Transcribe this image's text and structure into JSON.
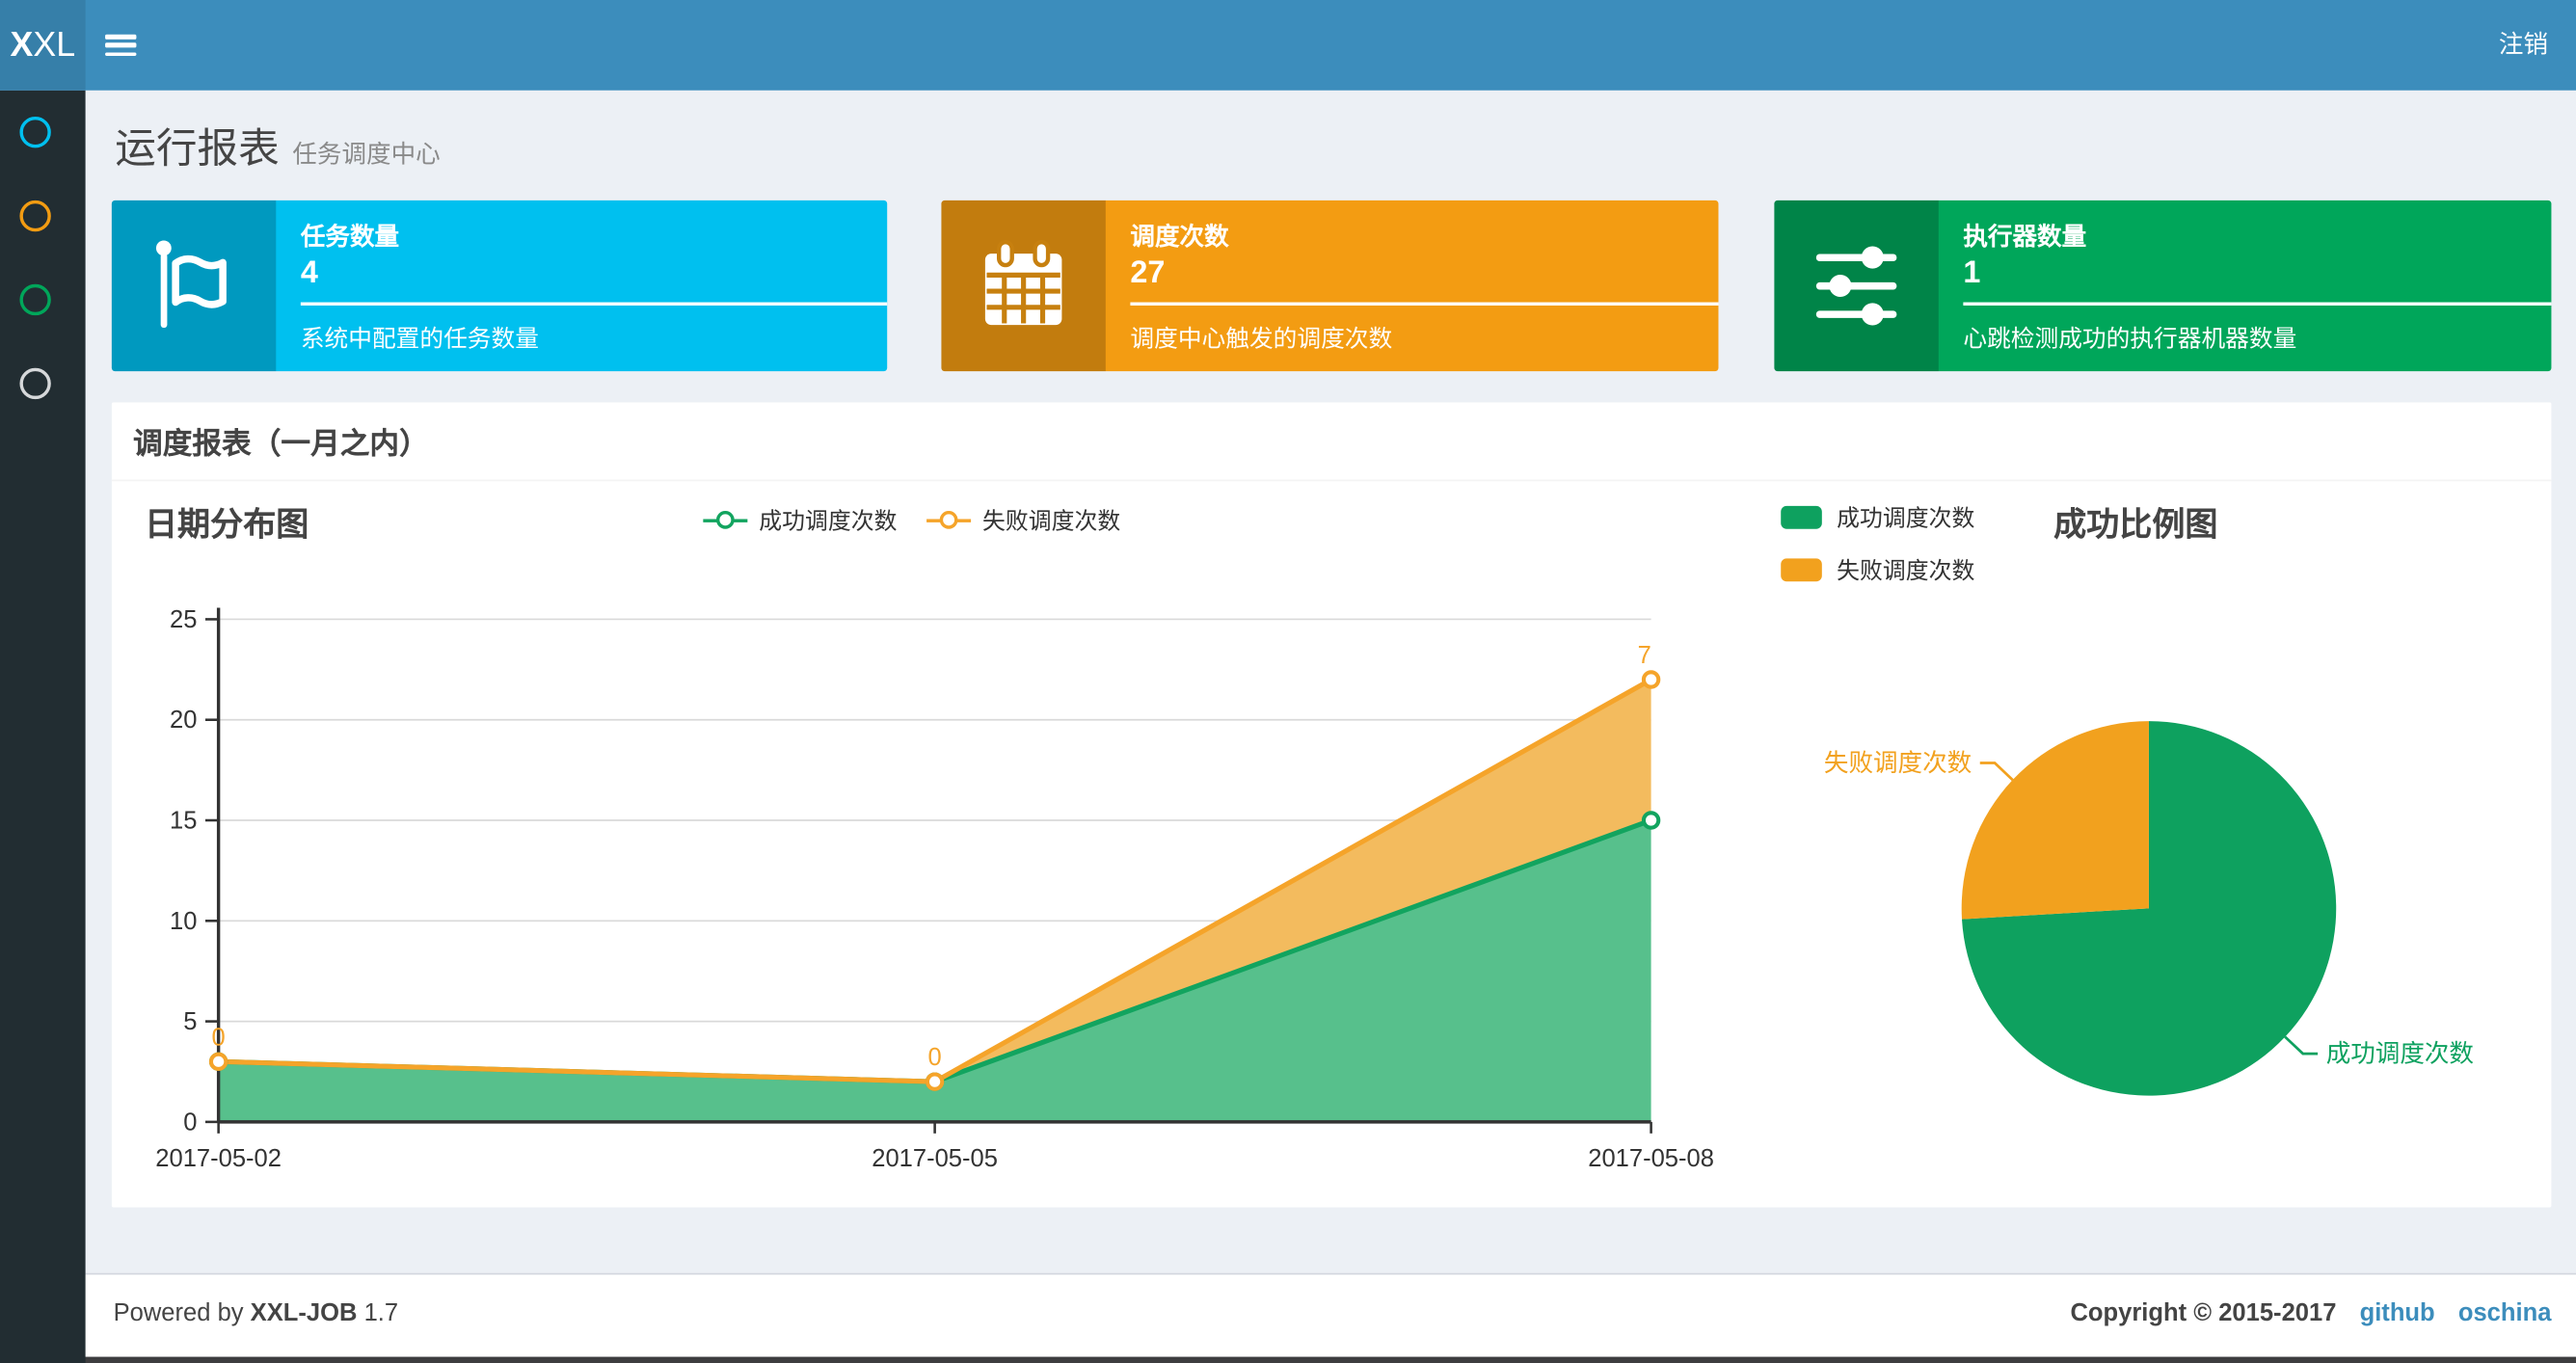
{
  "navbar": {
    "logo_bold": "X",
    "logo_rest": "XL",
    "logout_label": "注销"
  },
  "sidebar": {
    "items": [
      {
        "name": "menu-dot-aqua",
        "color": "#00c0ef"
      },
      {
        "name": "menu-dot-orange",
        "color": "#f39c12"
      },
      {
        "name": "menu-dot-green",
        "color": "#00a65a"
      },
      {
        "name": "menu-dot-white",
        "color": "#d6d8da"
      }
    ]
  },
  "page_header": {
    "title": "运行报表",
    "subtitle": "任务调度中心"
  },
  "info_boxes": [
    {
      "label": "任务数量",
      "value": "4",
      "desc": "系统中配置的任务数量",
      "color": "#00c0ef",
      "icon": "flag-icon"
    },
    {
      "label": "调度次数",
      "value": "27",
      "desc": "调度中心触发的调度次数",
      "color": "#f39c12",
      "icon": "calendar-icon"
    },
    {
      "label": "执行器数量",
      "value": "1",
      "desc": "心跳检测成功的执行器机器数量",
      "color": "#00a65a",
      "icon": "sliders-icon"
    }
  ],
  "panel": {
    "title": "调度报表（一月之内）"
  },
  "chart_data": [
    {
      "type": "area",
      "title": "日期分布图",
      "x": [
        "2017-05-02",
        "2017-05-05",
        "2017-05-08"
      ],
      "series": [
        {
          "name": "成功调度次数",
          "values": [
            3,
            2,
            15
          ],
          "line_color": "#12a45f",
          "area_color": "#57c08c"
        },
        {
          "name": "失败调度次数",
          "values": [
            0,
            0,
            7
          ],
          "line_color": "#f5a42a",
          "area_color": "#f3bb5e",
          "point_labels": [
            "0",
            "0",
            "7"
          ]
        }
      ],
      "stacked": true,
      "ylim": [
        0,
        25
      ],
      "yticks": [
        0,
        5,
        10,
        15,
        20,
        25
      ],
      "grid": true,
      "legend_position": "top-center"
    },
    {
      "type": "pie",
      "title": "成功比例图",
      "slices": [
        {
          "name": "成功调度次数",
          "value": 20,
          "color": "#0ea15f"
        },
        {
          "name": "失败调度次数",
          "value": 7,
          "color": "#f2a11e"
        }
      ],
      "legend_position": "left"
    }
  ],
  "footer": {
    "powered_prefix": "Powered by",
    "product": "XXL-JOB",
    "version": "1.7",
    "copyright": "Copyright © 2015-2017",
    "links": [
      "github",
      "oschina"
    ]
  }
}
